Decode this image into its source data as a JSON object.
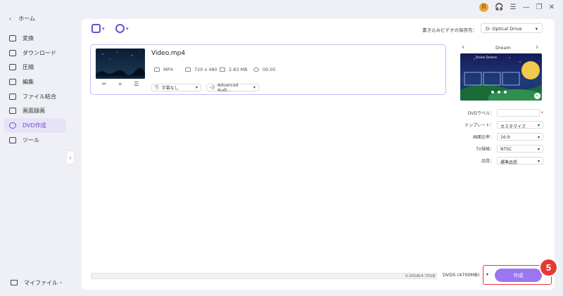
{
  "window": {
    "avatar_letter": "R"
  },
  "sidebar": {
    "home_label": "ホーム",
    "items": [
      {
        "label": "変換"
      },
      {
        "label": "ダウンロード"
      },
      {
        "label": "圧縮"
      },
      {
        "label": "編集"
      },
      {
        "label": "ファイル結合"
      },
      {
        "label": "画面録画"
      },
      {
        "label": "DVD作成",
        "active": true
      },
      {
        "label": "ツール"
      }
    ],
    "my_files_label": "マイファイル"
  },
  "toolbar": {
    "save_to_label": "書き込みビデオの保存先：",
    "save_to_value": "D: Optical Drive"
  },
  "video": {
    "title": "Video.mp4",
    "format": "MP4",
    "resolution": "720 x 480",
    "size": "2.83 MB",
    "duration": "00:05",
    "subtitle_option": "字幕なし",
    "audio_option": "Advanced Audi..."
  },
  "template": {
    "name": "Dream",
    "preview_title": "Dream Dreams"
  },
  "settings": {
    "dvd_label_label": "DVDラベル：",
    "dvd_label_value": "",
    "template_label": "テンプレート：",
    "template_value": "カスタマイズ",
    "aspect_label": "画面比率：",
    "aspect_value": "16:9",
    "tv_label": "TV規格：",
    "tv_value": "NTSC",
    "quality_label": "品質：",
    "quality_value": "標準品質"
  },
  "footer": {
    "usage_text": "0.00GB/4.70GB",
    "usage_fraction": 0.0,
    "disc_type": "DVD5 (4700MB)",
    "create_label": "作成"
  },
  "annotation": {
    "step_number": "5",
    "color": "#e53935"
  },
  "colors": {
    "accent": "#6d4ad8",
    "button": "#9a77f1"
  }
}
